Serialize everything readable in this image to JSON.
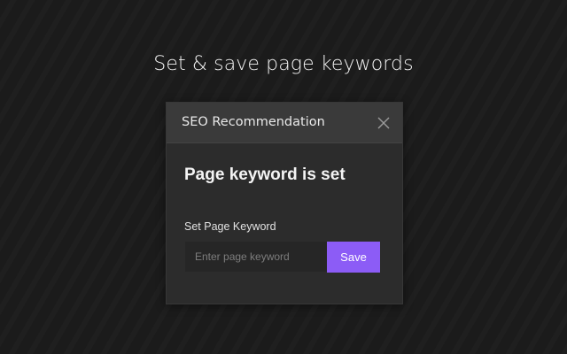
{
  "headline": "Set & save page keywords",
  "modal": {
    "title": "SEO Recommendation",
    "close_icon": "close-icon",
    "status": "Page keyword is set",
    "field_label": "Set Page Keyword",
    "input_value": "",
    "input_placeholder": "Enter page keyword",
    "save_label": "Save"
  },
  "colors": {
    "background": "#1b1b1b",
    "modal_body": "#2c2c2c",
    "modal_header": "#3a3a3a",
    "input_bg": "#262626",
    "accent": "#8c5cf6"
  }
}
